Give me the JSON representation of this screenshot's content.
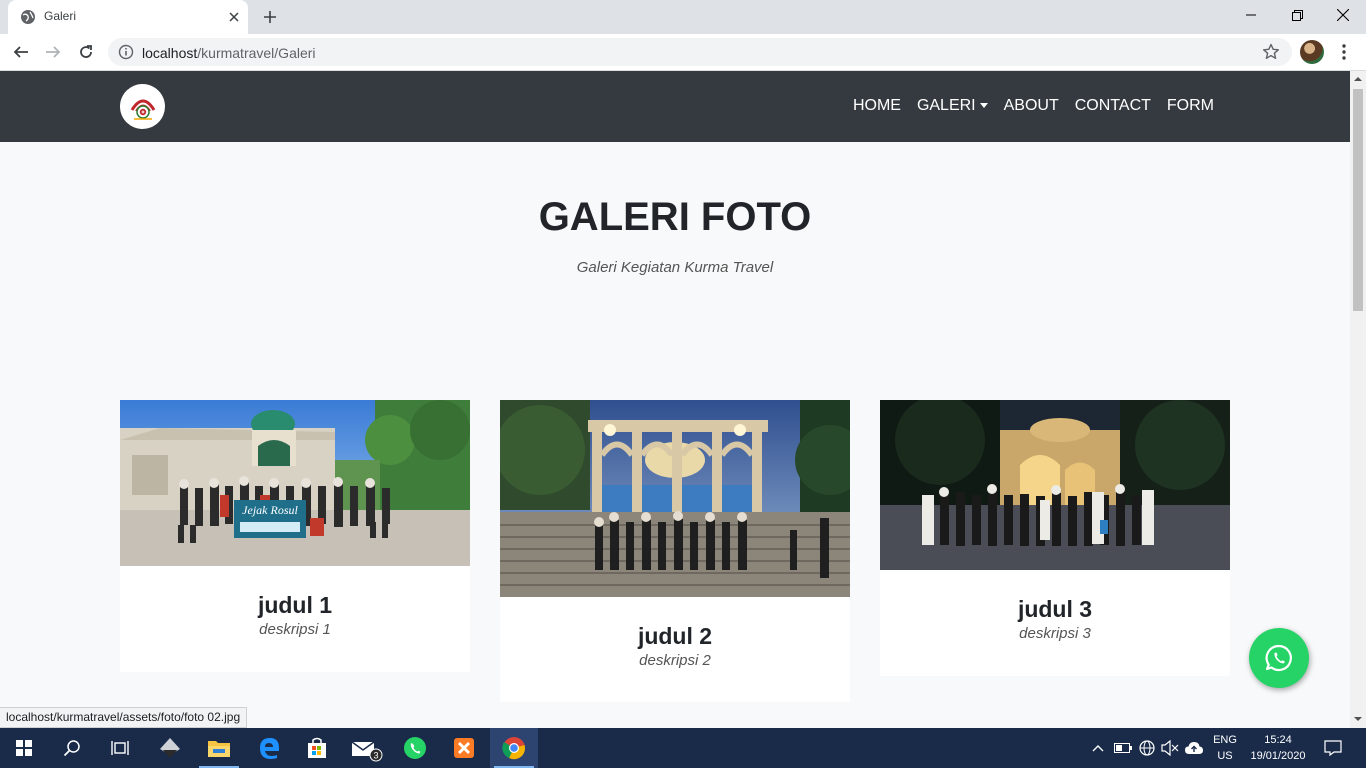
{
  "browser": {
    "tab_title": "Galeri",
    "url_host": "localhost",
    "url_path": "/kurmatravel/Galeri",
    "status_url": "localhost/kurmatravel/assets/foto/foto 02.jpg"
  },
  "navbar": {
    "links": [
      "HOME",
      "GALERI",
      "ABOUT",
      "CONTACT",
      "FORM"
    ]
  },
  "header": {
    "title": "GALERI FOTO",
    "subtitle": "Galeri Kegiatan Kurma Travel"
  },
  "cards": [
    {
      "title": "judul 1",
      "description": "deskripsi 1",
      "photo_banner": "Jejak Rosul"
    },
    {
      "title": "judul 2",
      "description": "deskripsi 2"
    },
    {
      "title": "judul 3",
      "description": "deskripsi 3"
    }
  ],
  "taskbar": {
    "lang_top": "ENG",
    "lang_bottom": "US",
    "time": "15:24",
    "date": "19/01/2020",
    "mail_badge": "3"
  },
  "colors": {
    "navbar": "#343a40",
    "whatsapp": "#25d366",
    "taskbar": "#1a2b4a"
  }
}
